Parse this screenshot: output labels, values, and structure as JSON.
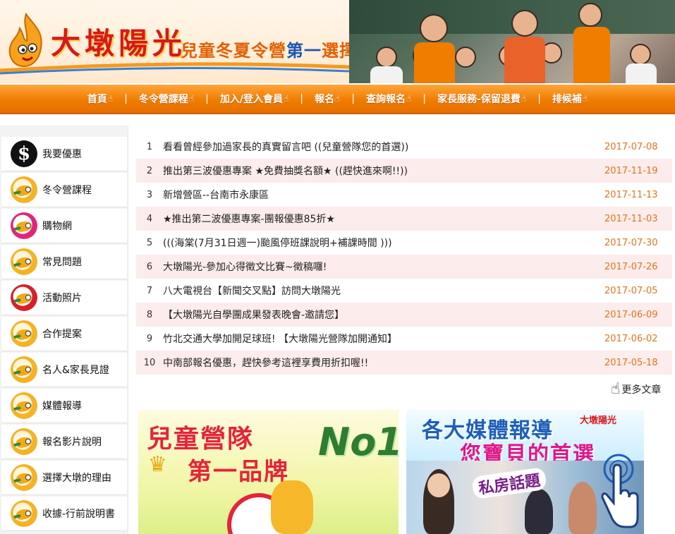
{
  "header": {
    "brand_title": "大墩陽光",
    "brand_sub_pre": "兒童冬夏令營",
    "brand_sub_hl": "第一",
    "brand_sub_post": "選擇"
  },
  "nav": {
    "items": [
      {
        "label": "首頁"
      },
      {
        "label": "冬令營課程"
      },
      {
        "label": "加入/登入會員"
      },
      {
        "label": "報名"
      },
      {
        "label": "查詢報名"
      },
      {
        "label": "家長服務-保留退費"
      },
      {
        "label": "排候補"
      }
    ],
    "separator": "|",
    "hand_glyph": "☝"
  },
  "sidebar": {
    "items": [
      {
        "label": "我要優惠",
        "icon": "dollar-coin-icon"
      },
      {
        "label": "冬令營課程",
        "icon": "mascot-icon"
      },
      {
        "label": "購物網",
        "icon": "mascot-icon"
      },
      {
        "label": "常見問題",
        "icon": "mascot-icon"
      },
      {
        "label": "活動照片",
        "icon": "mascot-icon"
      },
      {
        "label": "合作提案",
        "icon": "mascot-icon"
      },
      {
        "label": "名人&家長見證",
        "icon": "mascot-icon"
      },
      {
        "label": "媒體報導",
        "icon": "mascot-icon"
      },
      {
        "label": "報名影片說明",
        "icon": "mascot-icon"
      },
      {
        "label": "選擇大墩的理由",
        "icon": "mascot-icon"
      },
      {
        "label": "收據-行前說明書",
        "icon": "mascot-icon"
      }
    ]
  },
  "news": {
    "rows": [
      {
        "num": "1",
        "title": "看看曾經參加過家長的真實留言吧 ((兒童營隊您的首選))",
        "date": "2017-07-08"
      },
      {
        "num": "2",
        "title": "推出第三波優惠專案 ★免費抽獎名額★ ((趕快進來啊!!))",
        "date": "2017-11-19"
      },
      {
        "num": "3",
        "title": "新增營區--台南市永康區",
        "date": "2017-11-13"
      },
      {
        "num": "4",
        "title": "★推出第二波優惠專案-團報優惠85折★",
        "date": "2017-11-03"
      },
      {
        "num": "5",
        "title": "(((海棠(7月31日週一)颱風停班課說明+補課時間 )))",
        "date": "2017-07-30"
      },
      {
        "num": "6",
        "title": "大墩陽光-參加心得徵文比賽~徵稿囉!",
        "date": "2017-07-26"
      },
      {
        "num": "7",
        "title": "八大電視台【新聞交叉點】訪問大墩陽光",
        "date": "2017-07-05"
      },
      {
        "num": "8",
        "title": "【大墩陽光自學團成果發表晚會-邀請您】",
        "date": "2017-06-09"
      },
      {
        "num": "9",
        "title": "竹北交通大學加開足球班! 【大墩陽光營隊加開通知】",
        "date": "2017-06-02"
      },
      {
        "num": "10",
        "title": "中南部報名優惠，趕快參考這裡享費用折扣喔!!",
        "date": "2017-05-18"
      }
    ],
    "more_label": "更多文章"
  },
  "promo_left": {
    "line1": "兒童營隊",
    "line2": "第一品牌",
    "badge": "No1"
  },
  "promo_right": {
    "line1": "各大媒體報導",
    "line2": "您寶貝的首選",
    "brand": "大墩陽光",
    "show": "私房話題"
  },
  "colors": {
    "nav_orange": "#f07c00",
    "date_orange": "#e2741a",
    "brand_red": "#d8181c",
    "row_pink": "#fdecec"
  }
}
